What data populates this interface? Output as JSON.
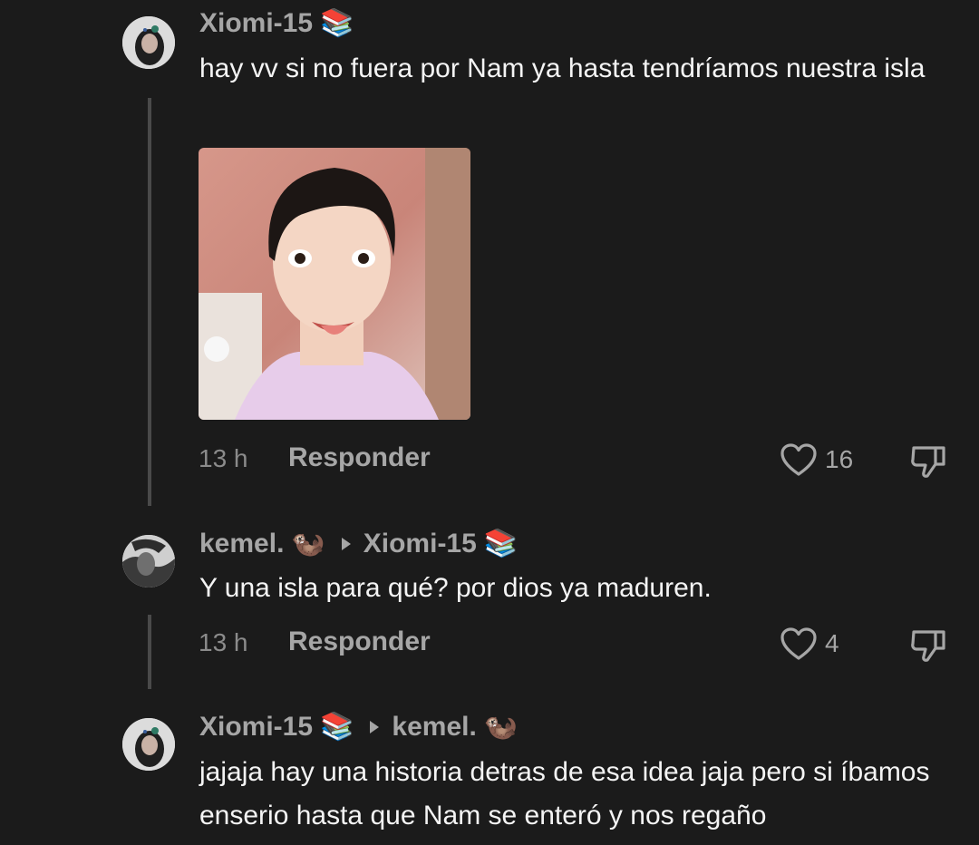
{
  "comments": [
    {
      "username": "Xiomi-15",
      "user_emoji": "📚",
      "text": "hay vv si no fuera por Nam ya hasta tendríamos nuestra isla",
      "time": "13 h",
      "reply_label": "Responder",
      "likes": "16",
      "has_image": true
    },
    {
      "username": "kemel.",
      "user_emoji": "🦦",
      "reply_to": "Xiomi-15",
      "reply_to_emoji": "📚",
      "text": "Y una isla para qué? por dios ya maduren.",
      "time": "13 h",
      "reply_label": "Responder",
      "likes": "4"
    },
    {
      "username": "Xiomi-15",
      "user_emoji": "📚",
      "reply_to": "kemel.",
      "reply_to_emoji": "🦦",
      "text": "jajaja hay una historia detras de esa idea jaja pero si íbamos enserio hasta que Nam se enteró y nos regaño"
    }
  ],
  "icons": {
    "like": "heart-outline-icon",
    "dislike": "thumbs-down-outline-icon",
    "reply_arrow": "triangle-right-icon"
  },
  "colors": {
    "background": "#1b1b1b",
    "username": "#a6a6a6",
    "text": "#f4f4f4",
    "meta": "#8b8b8b"
  }
}
